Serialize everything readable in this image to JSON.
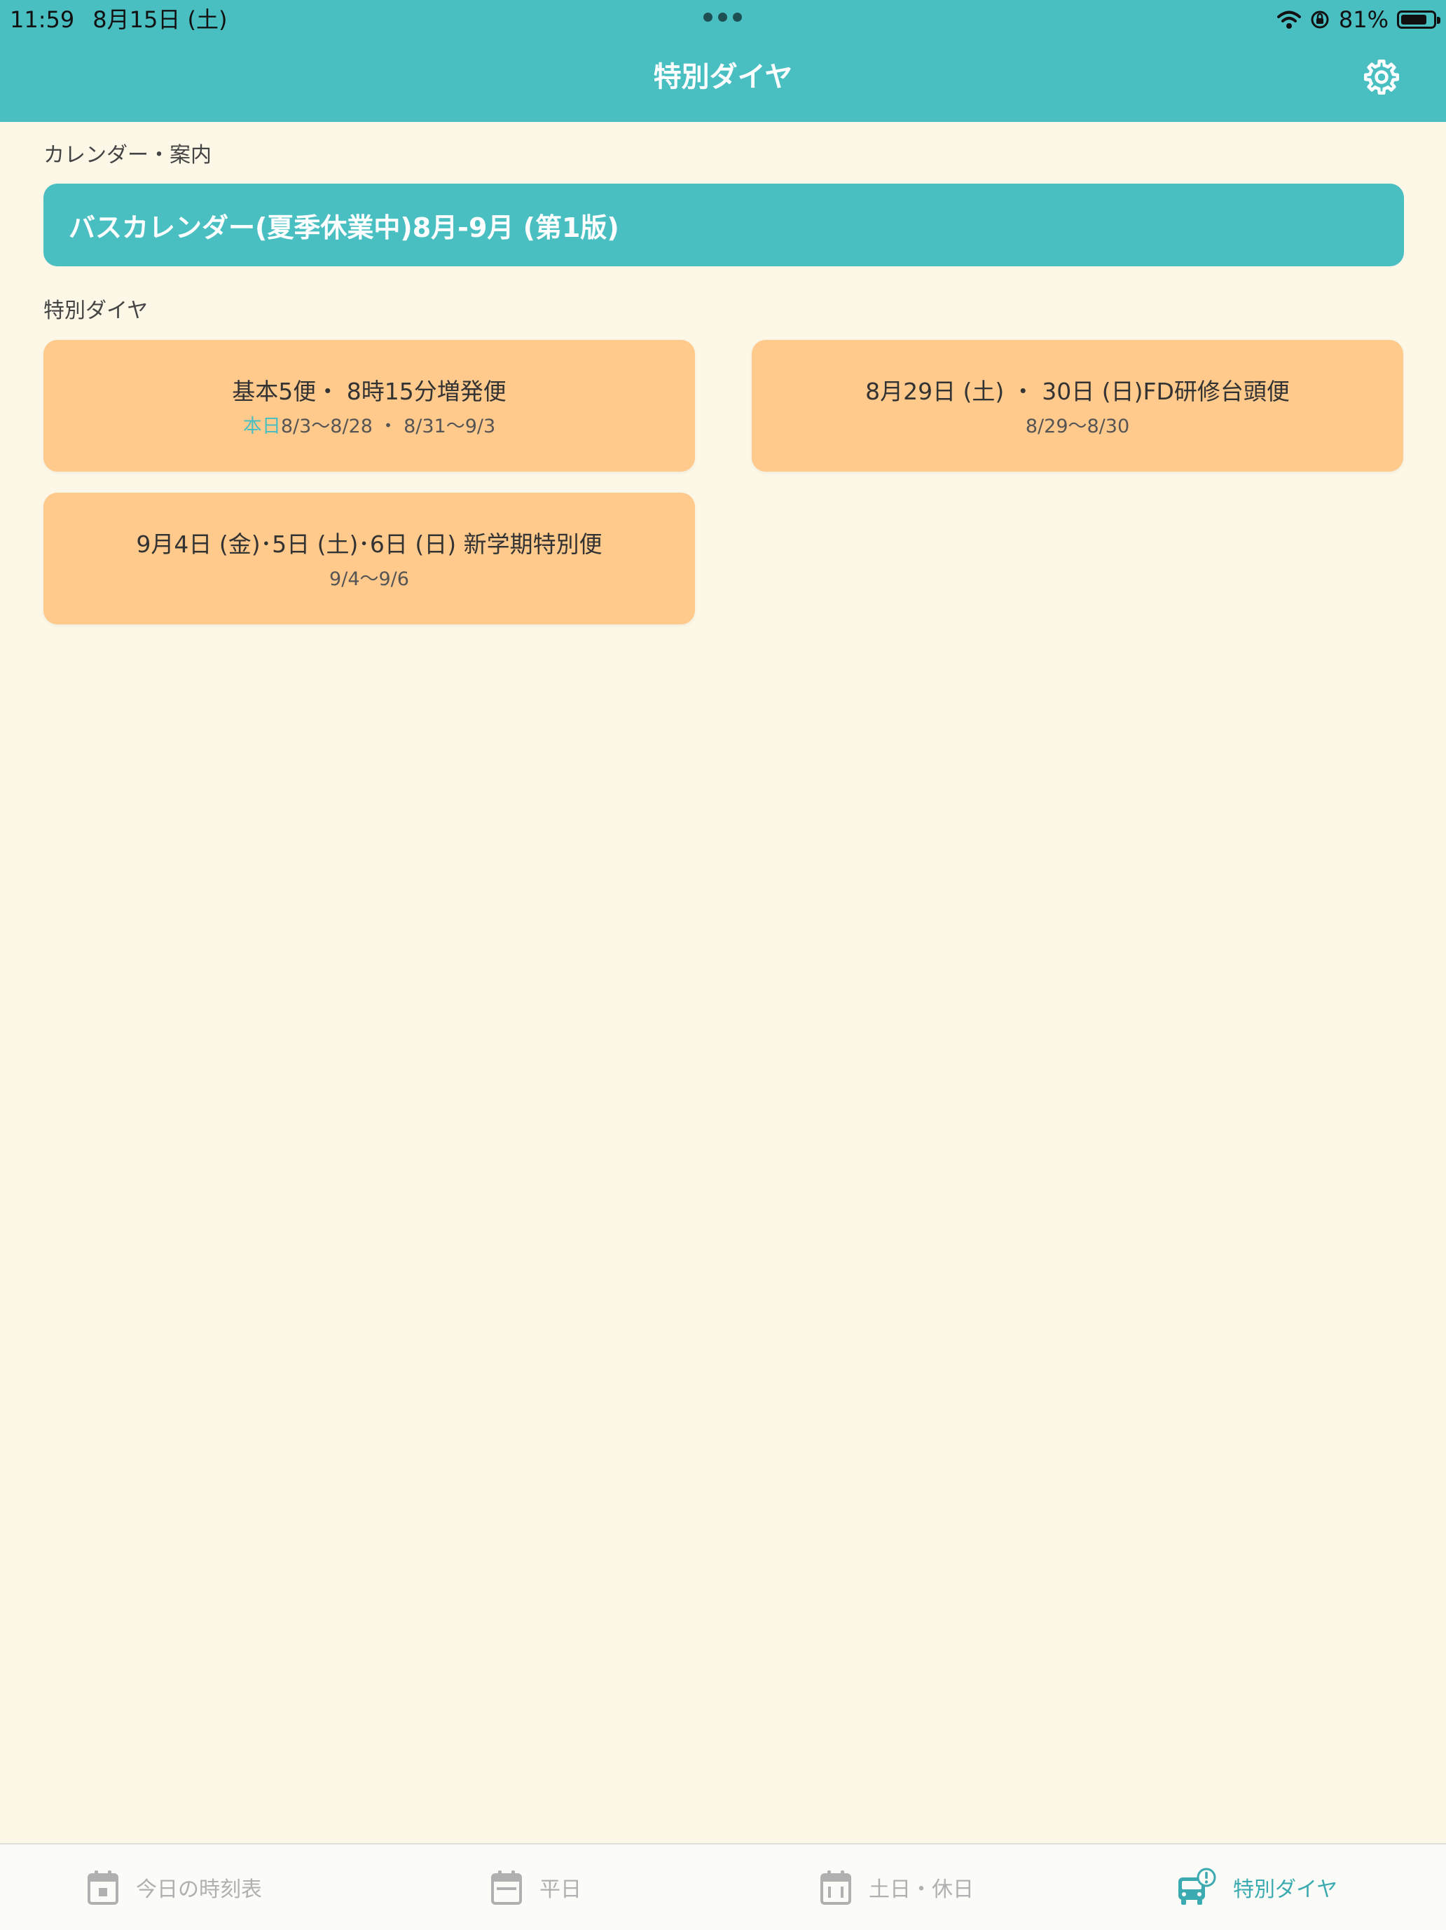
{
  "status_bar": {
    "time": "11:59",
    "date": "8月15日 (土)",
    "battery_percent": "81%",
    "battery_level": 0.81
  },
  "nav": {
    "title": "特別ダイヤ",
    "settings_icon": "gear-icon"
  },
  "calendar_section": {
    "label": "カレンダー・案内",
    "banner_label": "バスカレンダー(夏季休業中)8月-9月 (第1版)"
  },
  "special_section": {
    "label": "特別ダイヤ",
    "cards": [
      {
        "title": "基本5便・ 8時15分増発便",
        "badge": "本日",
        "dates": "8/3〜8/28 ・ 8/31〜9/3"
      },
      {
        "title": "8月29日 (土) ・ 30日 (日)FD研修台頭便",
        "badge": "",
        "dates": "8/29〜8/30"
      },
      {
        "title": "9月4日 (金)･5日 (土)･6日 (日) 新学期特別便",
        "badge": "",
        "dates": "9/4〜9/6"
      }
    ]
  },
  "tabbar": {
    "tabs": [
      {
        "label": "今日の時刻表",
        "icon": "calendar-today-icon",
        "active": false
      },
      {
        "label": "平日",
        "icon": "calendar-weekday-icon",
        "active": false
      },
      {
        "label": "土日・休日",
        "icon": "calendar-holiday-icon",
        "active": false
      },
      {
        "label": "特別ダイヤ",
        "icon": "bus-alert-icon",
        "active": true
      }
    ]
  },
  "colors": {
    "accent": "#4ABFC2",
    "card": "#FFCA8C",
    "background": "#FCF7E7",
    "tab_inactive": "#B0B0B0",
    "tab_active": "#3BAAB1"
  }
}
